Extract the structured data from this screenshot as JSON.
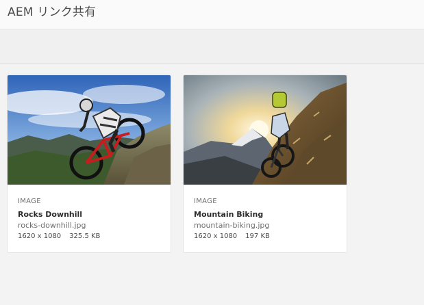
{
  "header": {
    "title": "AEM リンク共有"
  },
  "assets": [
    {
      "type": "IMAGE",
      "title": "Rocks Downhill",
      "filename": "rocks-downhill.jpg",
      "dimensions": "1620 x 1080",
      "size": "325.5 KB"
    },
    {
      "type": "IMAGE",
      "title": "Mountain Biking",
      "filename": "mountain-biking.jpg",
      "dimensions": "1620 x 1080",
      "size": "197 KB"
    }
  ],
  "colors": {
    "header_bg": "#fafafa",
    "toolbar_bg": "#f0f0f0",
    "content_bg": "#f3f3f3",
    "card_bg": "#ffffff"
  }
}
